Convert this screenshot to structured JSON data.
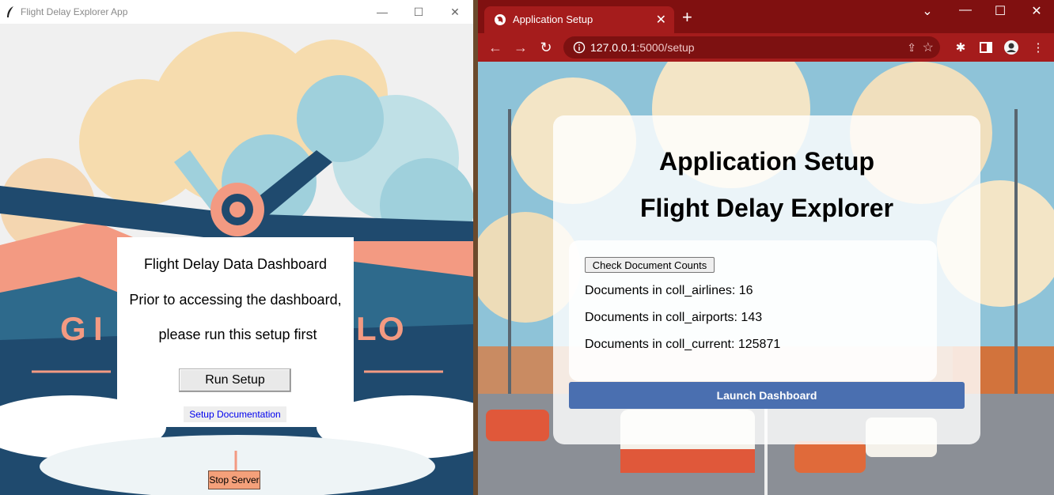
{
  "tk_app": {
    "window_title": "Flight Delay Explorer App",
    "controls": {
      "minimize": "—",
      "maximize": "☐",
      "close": "✕"
    },
    "heading": "Flight Delay Data Dashboard",
    "line1": "Prior to accessing the dashboard,",
    "line2": "please run this setup first",
    "run_button": "Run Setup",
    "doc_link": "Setup Documentation",
    "stop_button": "Stop Server",
    "background_letters": [
      "G",
      "I",
      "L",
      "O"
    ],
    "colors": {
      "panel": "#ffffff",
      "stop_button": "#f4a07a",
      "link": "#0000ee"
    }
  },
  "browser": {
    "tab_title": "Application Setup",
    "url_host": "127.0.0.1",
    "url_path": ":5000/setup",
    "controls": {
      "dropdown": "⌄",
      "minimize": "—",
      "maximize": "☐",
      "close": "✕"
    },
    "theme_color": "#a51c1c"
  },
  "page": {
    "title": "Application Setup",
    "subtitle": "Flight Delay Explorer",
    "check_button": "Check Document Counts",
    "counts": [
      {
        "label": "Documents in coll_airlines: 16"
      },
      {
        "label": "Documents in coll_airports: 143"
      },
      {
        "label": "Documents in coll_current: 125871"
      }
    ],
    "launch_button": "Launch Dashboard",
    "launch_color": "#4a6fb0"
  }
}
